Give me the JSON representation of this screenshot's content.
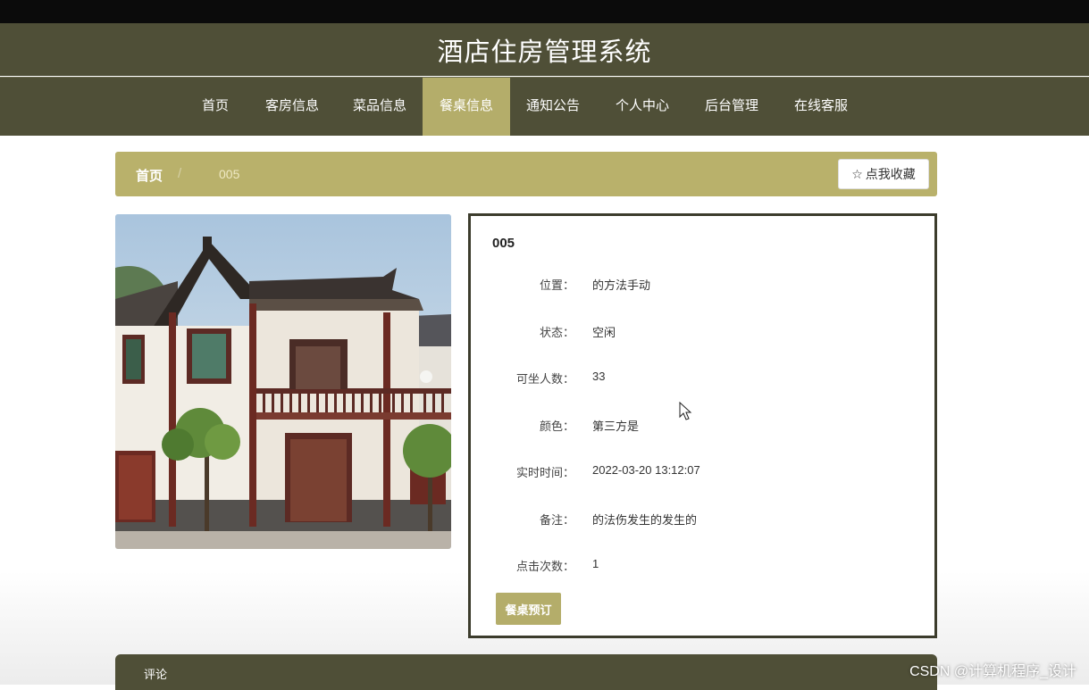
{
  "header": {
    "title": "酒店住房管理系统"
  },
  "nav": {
    "items": [
      {
        "label": "首页"
      },
      {
        "label": "客房信息"
      },
      {
        "label": "菜品信息"
      },
      {
        "label": "餐桌信息"
      },
      {
        "label": "通知公告"
      },
      {
        "label": "个人中心"
      },
      {
        "label": "后台管理"
      },
      {
        "label": "在线客服"
      }
    ],
    "active": "餐桌信息"
  },
  "breadcrumb": {
    "home": "首页",
    "separator": "/",
    "current": "005"
  },
  "favorite": {
    "label": "点我收藏",
    "icon": "star-outline-icon"
  },
  "detail": {
    "title": "005",
    "fields": [
      {
        "label": "位置：",
        "value": "的方法手动"
      },
      {
        "label": "状态：",
        "value": "空闲"
      },
      {
        "label": "可坐人数：",
        "value": "33"
      },
      {
        "label": "颜色：",
        "value": "第三方是"
      },
      {
        "label": "实时时间：",
        "value": "2022-03-20 13:12:07"
      },
      {
        "label": "备注：",
        "value": "的法伤发生的发生的"
      },
      {
        "label": "点击次数：",
        "value": "1"
      }
    ],
    "book_label": "餐桌预订"
  },
  "comments": {
    "label": "评论"
  },
  "watermark": "CSDN @计算机程序_设计",
  "colors": {
    "header": "#4f4f37",
    "accent": "#b4ad6a",
    "breadcrumb": "#b9b16b"
  }
}
